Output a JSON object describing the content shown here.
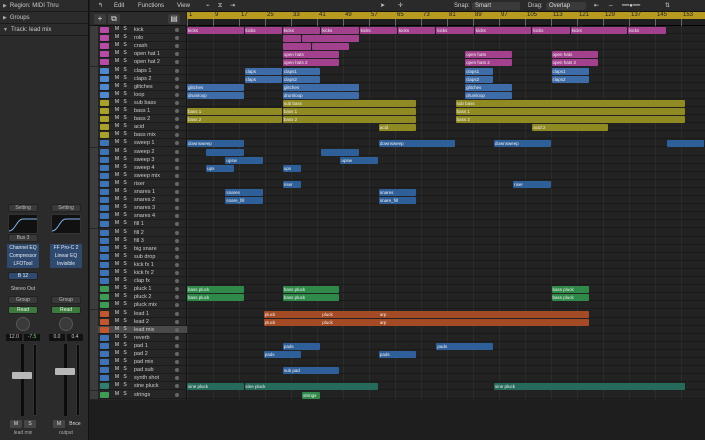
{
  "inspector": {
    "region_label": "Region: MIDI Thru",
    "groups_label": "Groups",
    "track_label": "Track: lead mix",
    "left_strip": {
      "setting": "Setting",
      "bus": "Bus 3",
      "plugins": [
        "Channel EQ",
        "Compressor",
        "LFOTool"
      ],
      "send": "B 12",
      "output": "Stereo Out",
      "group": "Group",
      "automation": "Read",
      "pan": "12.0",
      "level": "-7.5",
      "mute": "M",
      "solo": "S",
      "name": "lead mix"
    },
    "right_strip": {
      "setting": "Setting",
      "plugins": [
        "FF Pro-C 2",
        "Linear EQ",
        "Invisible"
      ],
      "group": "Group",
      "automation": "Read",
      "pan": "0.0",
      "level": "0.4",
      "mute": "M",
      "bounce": "Bnce",
      "name": "output"
    }
  },
  "toolbar": {
    "edit": "Edit",
    "functions": "Functions",
    "view": "View",
    "snap_label": "Snap:",
    "snap_value": "Smart",
    "drag_label": "Drag:",
    "drag_value": "Overlap"
  },
  "ruler": {
    "bars": [
      "1",
      "9",
      "17",
      "25",
      "33",
      "41",
      "49",
      "57",
      "65",
      "73",
      "81",
      "89",
      "97",
      "105",
      "113",
      "121",
      "129",
      "137",
      "145",
      "153"
    ]
  },
  "tracks": [
    {
      "name": "kick",
      "color": "#b74ba5"
    },
    {
      "name": "rolo",
      "color": "#b74ba5"
    },
    {
      "name": "crash",
      "color": "#b74ba5"
    },
    {
      "name": "open hat 1",
      "color": "#b74ba5"
    },
    {
      "name": "open hat 2",
      "color": "#b74ba5"
    },
    {
      "name": "claps 1",
      "color": "#4d88d0"
    },
    {
      "name": "claps 2",
      "color": "#4d88d0"
    },
    {
      "name": "glitches",
      "color": "#4d88d0"
    },
    {
      "name": "loop",
      "color": "#4d88d0"
    },
    {
      "name": "sub bass",
      "color": "#a9a22a"
    },
    {
      "name": "bass 1",
      "color": "#a9a22a"
    },
    {
      "name": "bass 2",
      "color": "#a9a22a"
    },
    {
      "name": "acid",
      "color": "#a9a22a"
    },
    {
      "name": "bass mix",
      "color": "#a9a22a"
    },
    {
      "name": "sweep 1",
      "color": "#3d74b8"
    },
    {
      "name": "sweep 2",
      "color": "#3d74b8"
    },
    {
      "name": "sweep 3",
      "color": "#3d74b8"
    },
    {
      "name": "sweep 4",
      "color": "#3d74b8"
    },
    {
      "name": "sweep mix",
      "color": "#3d74b8"
    },
    {
      "name": "riser",
      "color": "#3d74b8"
    },
    {
      "name": "snares 1",
      "color": "#3d74b8"
    },
    {
      "name": "snares 2",
      "color": "#3d74b8"
    },
    {
      "name": "snares 3",
      "color": "#3d74b8"
    },
    {
      "name": "snares 4",
      "color": "#3d74b8"
    },
    {
      "name": "fill 1",
      "color": "#3d74b8"
    },
    {
      "name": "fill 2",
      "color": "#3d74b8"
    },
    {
      "name": "fill 3",
      "color": "#3d74b8"
    },
    {
      "name": "big snare",
      "color": "#3d74b8"
    },
    {
      "name": "sub drop",
      "color": "#3d74b8"
    },
    {
      "name": "kick fx 1",
      "color": "#3d74b8"
    },
    {
      "name": "kick fx 2",
      "color": "#3d74b8"
    },
    {
      "name": "clap fx",
      "color": "#3d74b8"
    },
    {
      "name": "pluck 1",
      "color": "#3c9b57"
    },
    {
      "name": "pluck 2",
      "color": "#3c9b57"
    },
    {
      "name": "pluck mix",
      "color": "#3c9b57"
    },
    {
      "name": "lead 1",
      "color": "#c2572f"
    },
    {
      "name": "lead 2",
      "color": "#c2572f"
    },
    {
      "name": "lead mix",
      "color": "#c2572f"
    },
    {
      "name": "reverb",
      "color": "#3d74b8"
    },
    {
      "name": "pad 1",
      "color": "#3d74b8"
    },
    {
      "name": "pad 2",
      "color": "#3d74b8"
    },
    {
      "name": "pad mix",
      "color": "#3d74b8"
    },
    {
      "name": "pad sub",
      "color": "#3d74b8"
    },
    {
      "name": "synth shot",
      "color": "#3d74b8"
    },
    {
      "name": "sine pluck",
      "color": "#2f7f6e"
    },
    {
      "name": "strings",
      "color": "#3c9b57"
    }
  ],
  "track_buttons": {
    "mute": "M",
    "solo": "S"
  },
  "regions": [
    {
      "lane": 0,
      "start": 0,
      "end": 6,
      "label": "kicks",
      "color": "#a4418f"
    },
    {
      "lane": 0,
      "start": 6,
      "end": 10,
      "label": "kicks",
      "color": "#a4418f"
    },
    {
      "lane": 0,
      "start": 10,
      "end": 14,
      "label": "kicks",
      "color": "#a4418f"
    },
    {
      "lane": 0,
      "start": 14,
      "end": 18,
      "label": "kicks",
      "color": "#a4418f"
    },
    {
      "lane": 0,
      "start": 18,
      "end": 22,
      "label": "kicks",
      "color": "#a4418f"
    },
    {
      "lane": 0,
      "start": 22,
      "end": 26,
      "label": "kicks",
      "color": "#a4418f"
    },
    {
      "lane": 0,
      "start": 26,
      "end": 30,
      "label": "kicks",
      "color": "#a4418f"
    },
    {
      "lane": 0,
      "start": 30,
      "end": 36,
      "label": "kicks",
      "color": "#a4418f"
    },
    {
      "lane": 0,
      "start": 36,
      "end": 40,
      "label": "kicks",
      "color": "#a4418f"
    },
    {
      "lane": 0,
      "start": 40,
      "end": 46,
      "label": "kicks",
      "color": "#a4418f"
    },
    {
      "lane": 0,
      "start": 46,
      "end": 50,
      "label": "kicks",
      "color": "#a4418f"
    },
    {
      "lane": 1,
      "start": 10,
      "end": 12,
      "label": "",
      "color": "#a4418f"
    },
    {
      "lane": 1,
      "start": 12,
      "end": 18,
      "label": "",
      "color": "#a4418f"
    },
    {
      "lane": 2,
      "start": 10,
      "end": 13,
      "label": "",
      "color": "#a4418f"
    },
    {
      "lane": 2,
      "start": 13,
      "end": 17,
      "label": "",
      "color": "#a4418f"
    },
    {
      "lane": 3,
      "start": 10,
      "end": 16,
      "label": "open hats",
      "color": "#a4418f"
    },
    {
      "lane": 3,
      "start": 29,
      "end": 34,
      "label": "open hats",
      "color": "#a4418f"
    },
    {
      "lane": 3,
      "start": 38,
      "end": 43,
      "label": "open hats",
      "color": "#a4418f"
    },
    {
      "lane": 4,
      "start": 10,
      "end": 16,
      "label": "open hats 2",
      "color": "#a4418f"
    },
    {
      "lane": 4,
      "start": 29,
      "end": 34,
      "label": "open hats 2",
      "color": "#a4418f"
    },
    {
      "lane": 4,
      "start": 38,
      "end": 43,
      "label": "open hats 2",
      "color": "#a4418f"
    },
    {
      "lane": 5,
      "start": 6,
      "end": 10,
      "label": "claps",
      "color": "#3d6ca9"
    },
    {
      "lane": 5,
      "start": 10,
      "end": 14,
      "label": "claps1",
      "color": "#3d6ca9"
    },
    {
      "lane": 5,
      "start": 29,
      "end": 32,
      "label": "claps1",
      "color": "#3d6ca9"
    },
    {
      "lane": 5,
      "start": 38,
      "end": 42,
      "label": "claps1",
      "color": "#3d6ca9"
    },
    {
      "lane": 6,
      "start": 6,
      "end": 10,
      "label": "claps",
      "color": "#3d6ca9"
    },
    {
      "lane": 6,
      "start": 10,
      "end": 14,
      "label": "claps2",
      "color": "#3d6ca9"
    },
    {
      "lane": 6,
      "start": 29,
      "end": 32,
      "label": "claps2",
      "color": "#3d6ca9"
    },
    {
      "lane": 6,
      "start": 38,
      "end": 42,
      "label": "claps2",
      "color": "#3d6ca9"
    },
    {
      "lane": 7,
      "start": 0,
      "end": 6,
      "label": "glitches",
      "color": "#3d6ca9"
    },
    {
      "lane": 7,
      "start": 10,
      "end": 18,
      "label": "glitches",
      "color": "#3d6ca9"
    },
    {
      "lane": 7,
      "start": 29,
      "end": 34,
      "label": "glitches",
      "color": "#3d6ca9"
    },
    {
      "lane": 8,
      "start": 0,
      "end": 6,
      "label": "drumloop",
      "color": "#3d6ca9"
    },
    {
      "lane": 8,
      "start": 10,
      "end": 18,
      "label": "drumloop",
      "color": "#3d6ca9"
    },
    {
      "lane": 8,
      "start": 29,
      "end": 34,
      "label": "drumloop",
      "color": "#3d6ca9"
    },
    {
      "lane": 9,
      "start": 10,
      "end": 24,
      "label": "sub bass",
      "color": "#8f8a22"
    },
    {
      "lane": 9,
      "start": 28,
      "end": 52,
      "label": "sub bass",
      "color": "#8f8a22"
    },
    {
      "lane": 10,
      "start": 0,
      "end": 10,
      "label": "bass 1",
      "color": "#8f8a22"
    },
    {
      "lane": 10,
      "start": 10,
      "end": 24,
      "label": "bass 1",
      "color": "#8f8a22"
    },
    {
      "lane": 10,
      "start": 28,
      "end": 52,
      "label": "bass 1",
      "color": "#8f8a22"
    },
    {
      "lane": 11,
      "start": 0,
      "end": 10,
      "label": "bass 2",
      "color": "#8f8a22"
    },
    {
      "lane": 11,
      "start": 10,
      "end": 24,
      "label": "bass 2",
      "color": "#8f8a22"
    },
    {
      "lane": 11,
      "start": 28,
      "end": 52,
      "label": "bass 2",
      "color": "#8f8a22"
    },
    {
      "lane": 12,
      "start": 20,
      "end": 24,
      "label": "acid",
      "color": "#8f8a22"
    },
    {
      "lane": 12,
      "start": 36,
      "end": 44,
      "label": "acid 2",
      "color": "#8f8a22"
    },
    {
      "lane": 14,
      "start": 0,
      "end": 6,
      "label": "downsweep",
      "color": "#2f5f99"
    },
    {
      "lane": 14,
      "start": 20,
      "end": 28,
      "label": "downsweep",
      "color": "#2f5f99"
    },
    {
      "lane": 14,
      "start": 32,
      "end": 38,
      "label": "downsweep",
      "color": "#2f5f99"
    },
    {
      "lane": 14,
      "start": 50,
      "end": 54,
      "label": "",
      "color": "#2f5f99"
    },
    {
      "lane": 15,
      "start": 2,
      "end": 6,
      "label": "",
      "color": "#2f5f99"
    },
    {
      "lane": 15,
      "start": 14,
      "end": 18,
      "label": "",
      "color": "#2f5f99"
    },
    {
      "lane": 16,
      "start": 4,
      "end": 8,
      "label": "upsw",
      "color": "#2f5f99"
    },
    {
      "lane": 16,
      "start": 16,
      "end": 20,
      "label": "upsw",
      "color": "#2f5f99"
    },
    {
      "lane": 17,
      "start": 2,
      "end": 5,
      "label": "ups",
      "color": "#2f5f99"
    },
    {
      "lane": 17,
      "start": 10,
      "end": 12,
      "label": "ups",
      "color": "#2f5f99"
    },
    {
      "lane": 19,
      "start": 10,
      "end": 12,
      "label": "riser",
      "color": "#2f5f99"
    },
    {
      "lane": 19,
      "start": 34,
      "end": 38,
      "label": "riser",
      "color": "#2f5f99"
    },
    {
      "lane": 20,
      "start": 4,
      "end": 8,
      "label": "snares",
      "color": "#2f5f99"
    },
    {
      "lane": 20,
      "start": 20,
      "end": 24,
      "label": "snares",
      "color": "#2f5f99"
    },
    {
      "lane": 21,
      "start": 4,
      "end": 8,
      "label": "snare_fill",
      "color": "#2f5f99"
    },
    {
      "lane": 21,
      "start": 20,
      "end": 24,
      "label": "snare_fill",
      "color": "#2f5f99"
    },
    {
      "lane": 32,
      "start": 0,
      "end": 6,
      "label": "bass pluck",
      "color": "#2f8a4a"
    },
    {
      "lane": 32,
      "start": 10,
      "end": 16,
      "label": "bass pluck",
      "color": "#2f8a4a"
    },
    {
      "lane": 32,
      "start": 38,
      "end": 42,
      "label": "bass pluck",
      "color": "#2f8a4a"
    },
    {
      "lane": 33,
      "start": 0,
      "end": 6,
      "label": "bass pluck",
      "color": "#2f8a4a"
    },
    {
      "lane": 33,
      "start": 10,
      "end": 16,
      "label": "bass pluck",
      "color": "#2f8a4a"
    },
    {
      "lane": 33,
      "start": 38,
      "end": 42,
      "label": "bass pluck",
      "color": "#2f8a4a"
    },
    {
      "lane": 35,
      "start": 8,
      "end": 16,
      "label": "pluck",
      "color": "#a44a24"
    },
    {
      "lane": 35,
      "start": 14,
      "end": 22,
      "label": "pluck",
      "color": "#a44a24"
    },
    {
      "lane": 35,
      "start": 20,
      "end": 42,
      "label": "arp",
      "color": "#a44a24"
    },
    {
      "lane": 36,
      "start": 8,
      "end": 16,
      "label": "pluck",
      "color": "#a44a24"
    },
    {
      "lane": 36,
      "start": 14,
      "end": 22,
      "label": "pluck",
      "color": "#a44a24"
    },
    {
      "lane": 36,
      "start": 20,
      "end": 42,
      "label": "arp",
      "color": "#a44a24"
    },
    {
      "lane": 39,
      "start": 10,
      "end": 14,
      "label": "pads",
      "color": "#2f5f99"
    },
    {
      "lane": 39,
      "start": 26,
      "end": 32,
      "label": "pads",
      "color": "#2f5f99"
    },
    {
      "lane": 40,
      "start": 8,
      "end": 12,
      "label": "pads",
      "color": "#2f5f99"
    },
    {
      "lane": 40,
      "start": 20,
      "end": 24,
      "label": "pads",
      "color": "#2f5f99"
    },
    {
      "lane": 42,
      "start": 10,
      "end": 16,
      "label": "sub pad",
      "color": "#2f5f99"
    },
    {
      "lane": 44,
      "start": 0,
      "end": 6,
      "label": "sine pluck",
      "color": "#256a5a"
    },
    {
      "lane": 44,
      "start": 6,
      "end": 20,
      "label": "sine pluck",
      "color": "#256a5a"
    },
    {
      "lane": 44,
      "start": 32,
      "end": 52,
      "label": "sine pluck",
      "color": "#256a5a"
    },
    {
      "lane": 45,
      "start": 12,
      "end": 14,
      "label": "strings",
      "color": "#2f8a4a"
    }
  ]
}
